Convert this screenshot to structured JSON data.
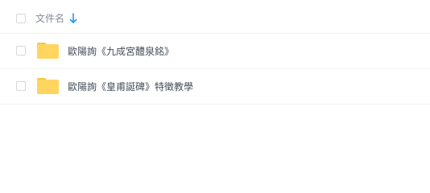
{
  "header": {
    "column_label": "文件名",
    "sort_icon": "arrow-down-icon"
  },
  "files": [
    {
      "name": "歐陽詢《九成宮醴泉銘》",
      "icon": "folder-icon"
    },
    {
      "name": "歐陽詢《皇甫誕碑》特徵教學",
      "icon": "folder-icon"
    }
  ],
  "colors": {
    "folder": "#ffd560",
    "folder_tab": "#f5c543",
    "sort_arrow": "#2196f3",
    "checkbox_border": "#d6d7db",
    "divider": "#f2f2f4",
    "header_text": "#878c9c",
    "row_text": "#454d5a"
  }
}
